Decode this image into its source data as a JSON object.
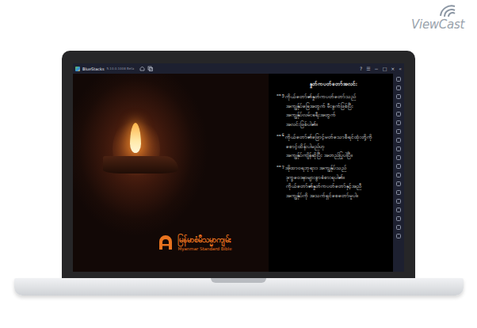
{
  "brand": {
    "name": "ViewCast"
  },
  "window": {
    "title": "BlueStacks",
    "subtitle": "5.10.0.1008 Beta",
    "controls": [
      "?",
      "☰",
      "−",
      "□",
      "×",
      "«"
    ]
  },
  "app": {
    "logo_title": "မြန်မာစံမီသမ္မာကျမ်း",
    "logo_subtitle": "Myanmar Standard Bible"
  },
  "passage": {
    "heading": "နှုတ်ကပတ်တော်အလင်း",
    "verses": [
      {
        "number": "၁၀၅",
        "lines": [
          "ကိုယ်တော်၏နှုတ်ကပတ်တော်သည်",
          "အကျွန်ုပ်ခြေအတွက် မီးခွက်ဖြစ်ပြီး",
          "အကျွန်ုပ်လမ်းခရီးအတွက်",
          "အလင်းဖြစ်ပါ၏။"
        ]
      },
      {
        "number": "၁၀၆",
        "lines": [
          "ကိုယ်တော်၏ဖြောင့်မတ်သောစီရင်ထုံးတို့ကို",
          "စောင့်ထိန်းပါမည်ဟု",
          "အကျွန်ုပ်ကျိန်ဆိုပြီး အတည်ပြုပါပြီ။"
        ]
      },
      {
        "number": "၁၀၇",
        "lines": [
          "အိုထာဝရဘုရား၊ အကျွန်ုပ်သည်",
          "ဒုက္ခဝေဒနာများစွာခံစားရပါ၏။",
          "ကိုယ်တော်၏နှုတ်ကပတ်တော်နှင့်အညီ",
          "အကျွန်ုပ်ကို အသက်ရှင်စေတော်မူပါ။"
        ]
      }
    ]
  }
}
